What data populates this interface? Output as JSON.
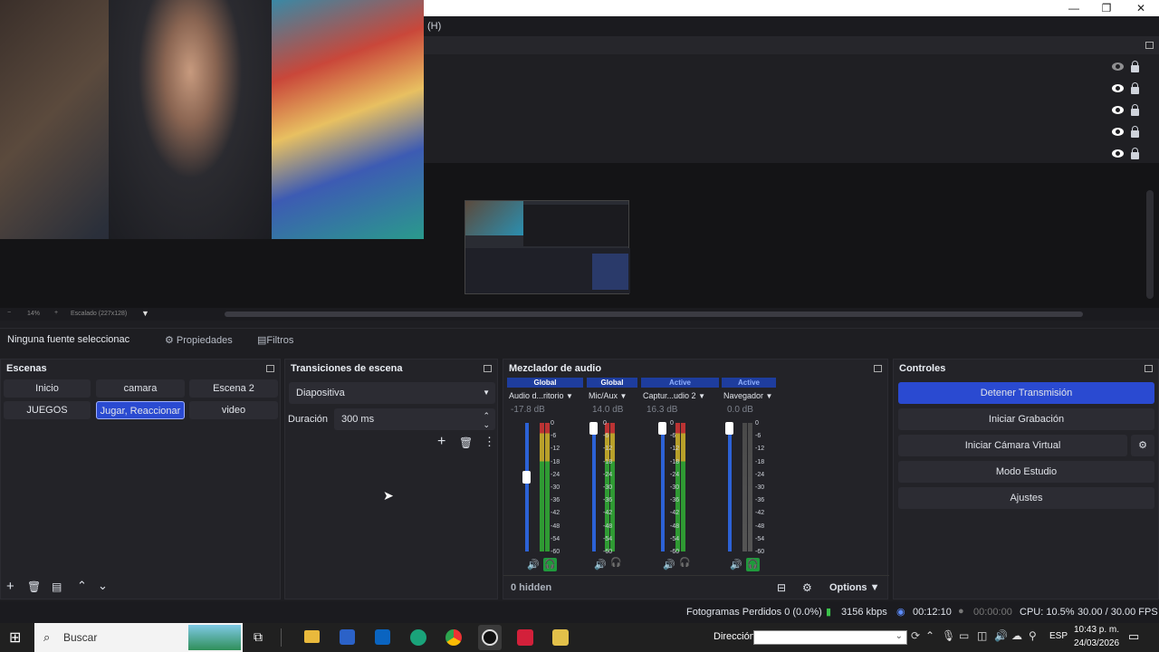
{
  "window": {
    "menu_fragment": "(H)",
    "minimize": "—",
    "maximize": "❐",
    "close": "✕"
  },
  "preview": {
    "zoom_minus": "−",
    "zoom_value": "14%",
    "zoom_plus": "+",
    "scale_label": "Escalado (227x128)"
  },
  "propbar": {
    "no_source": "Ninguna fuente seleccionac",
    "properties": "Propiedades",
    "filters": "Filtros"
  },
  "scenes": {
    "title": "Escenas",
    "items": [
      "Inicio",
      "camara",
      "Escena 2",
      "JUEGOS",
      "Jugar, Reaccionar",
      "video"
    ],
    "selected": "Jugar, Reaccionar"
  },
  "transitions": {
    "title": "Transiciones de escena",
    "selected": "Diapositiva",
    "duration_label": "Duración",
    "duration_value": "300 ms"
  },
  "mixer": {
    "title": "Mezclador de audio",
    "channels": [
      {
        "tag": "Global",
        "name": "Audio d...ritorio",
        "db": "-17.8 dB",
        "level": 0.6
      },
      {
        "tag": "Global",
        "name": "Mic/Aux",
        "db": "14.0 dB",
        "level": 0.98
      },
      {
        "tag": "Active",
        "name": "Captur...udio 2",
        "db": "16.3 dB",
        "level": 0.98
      },
      {
        "tag": "Active",
        "name": "Navegador",
        "db": "0.0 dB",
        "level": 0.98
      }
    ],
    "scale": [
      "0",
      "-6",
      "-12",
      "-18",
      "-24",
      "-30",
      "-36",
      "-42",
      "-48",
      "-54",
      "-60"
    ],
    "hidden": "0 hidden",
    "options": "Options"
  },
  "controls": {
    "title": "Controles",
    "stop_stream": "Detener Transmisión",
    "start_recording": "Iniciar Grabación",
    "virtual_camera": "Iniciar Cámara Virtual",
    "studio_mode": "Modo Estudio",
    "settings": "Ajustes"
  },
  "status": {
    "dropped": "Fotogramas Perdidos 0 (0.0%)",
    "bitrate": "3156 kbps",
    "live_time": "00:12:10",
    "rec_time": "00:00:00",
    "cpu": "CPU: 10.5%",
    "fps": "30.00 / 30.00 FPS"
  },
  "taskbar": {
    "search_placeholder": "Buscar",
    "address_label": "Dirección",
    "language": "ESP",
    "time": "10:43 p. m.",
    "date": "24/03/2026"
  },
  "colors": {
    "accent": "#2a4ad1",
    "meter_green": "#2f9a33",
    "meter_yellow": "#b8a02a",
    "meter_red": "#b33333"
  }
}
